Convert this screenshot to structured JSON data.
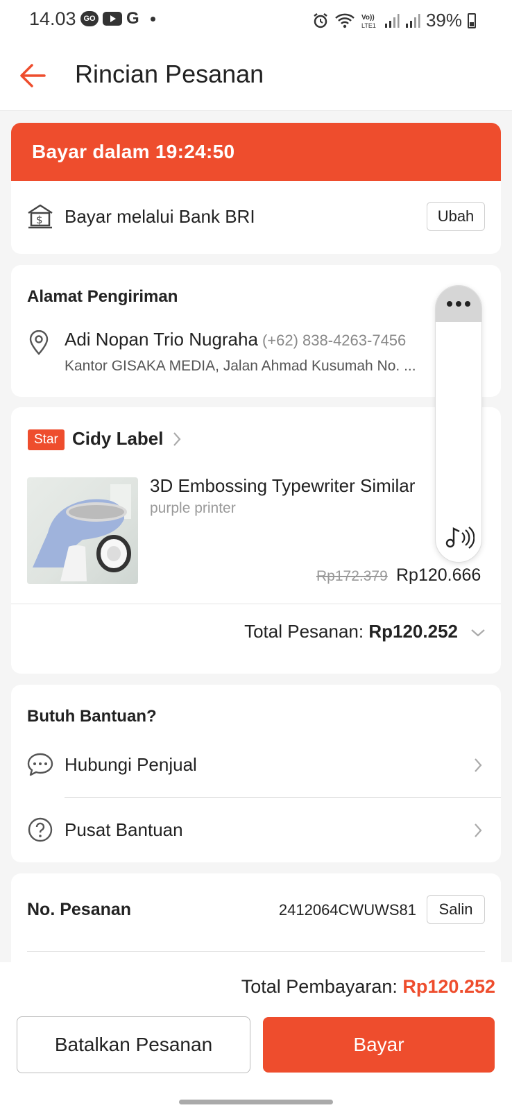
{
  "status_bar": {
    "time": "14.03",
    "left_icons": [
      "go-icon",
      "youtube-icon",
      "google-icon",
      "dot-icon"
    ],
    "right_icons": [
      "alarm-icon",
      "wifi-icon",
      "volte-icon",
      "signal-icon",
      "signal-icon"
    ],
    "volte_label": "Vo)) LTE1",
    "battery": "39%"
  },
  "header": {
    "title": "Rincian Pesanan"
  },
  "payment": {
    "banner": "Bayar dalam 19:24:50",
    "method": "Bayar melalui Bank BRI",
    "change_label": "Ubah"
  },
  "address": {
    "title": "Alamat Pengiriman",
    "name": "Adi Nopan Trio Nugraha",
    "phone": "(+62) 838-4263-7456",
    "line": "Kantor GISAKA MEDIA, Jalan Ahmad Kusumah No. ..."
  },
  "shop": {
    "badge": "Star",
    "name": "Cidy Label",
    "product_name": "3D Embossing Typewriter Similar",
    "variant": "purple printer",
    "price_old": "Rp172.379",
    "price_new": "Rp120.666",
    "total_label": "Total Pesanan:",
    "total_value": "Rp120.252"
  },
  "help": {
    "title": "Butuh Bantuan?",
    "items": [
      {
        "label": "Hubungi Penjual",
        "icon": "chat-icon"
      },
      {
        "label": "Pusat Bantuan",
        "icon": "question-icon"
      }
    ]
  },
  "order": {
    "label": "No. Pesanan",
    "number": "2412064CWUWS81",
    "copy_label": "Salin"
  },
  "bottom": {
    "total_label": "Total Pembayaran:",
    "total_value": "Rp120.252",
    "cancel_label": "Batalkan Pesanan",
    "pay_label": "Bayar"
  },
  "colors": {
    "accent": "#ee4d2d",
    "background": "#f5f5f5"
  }
}
